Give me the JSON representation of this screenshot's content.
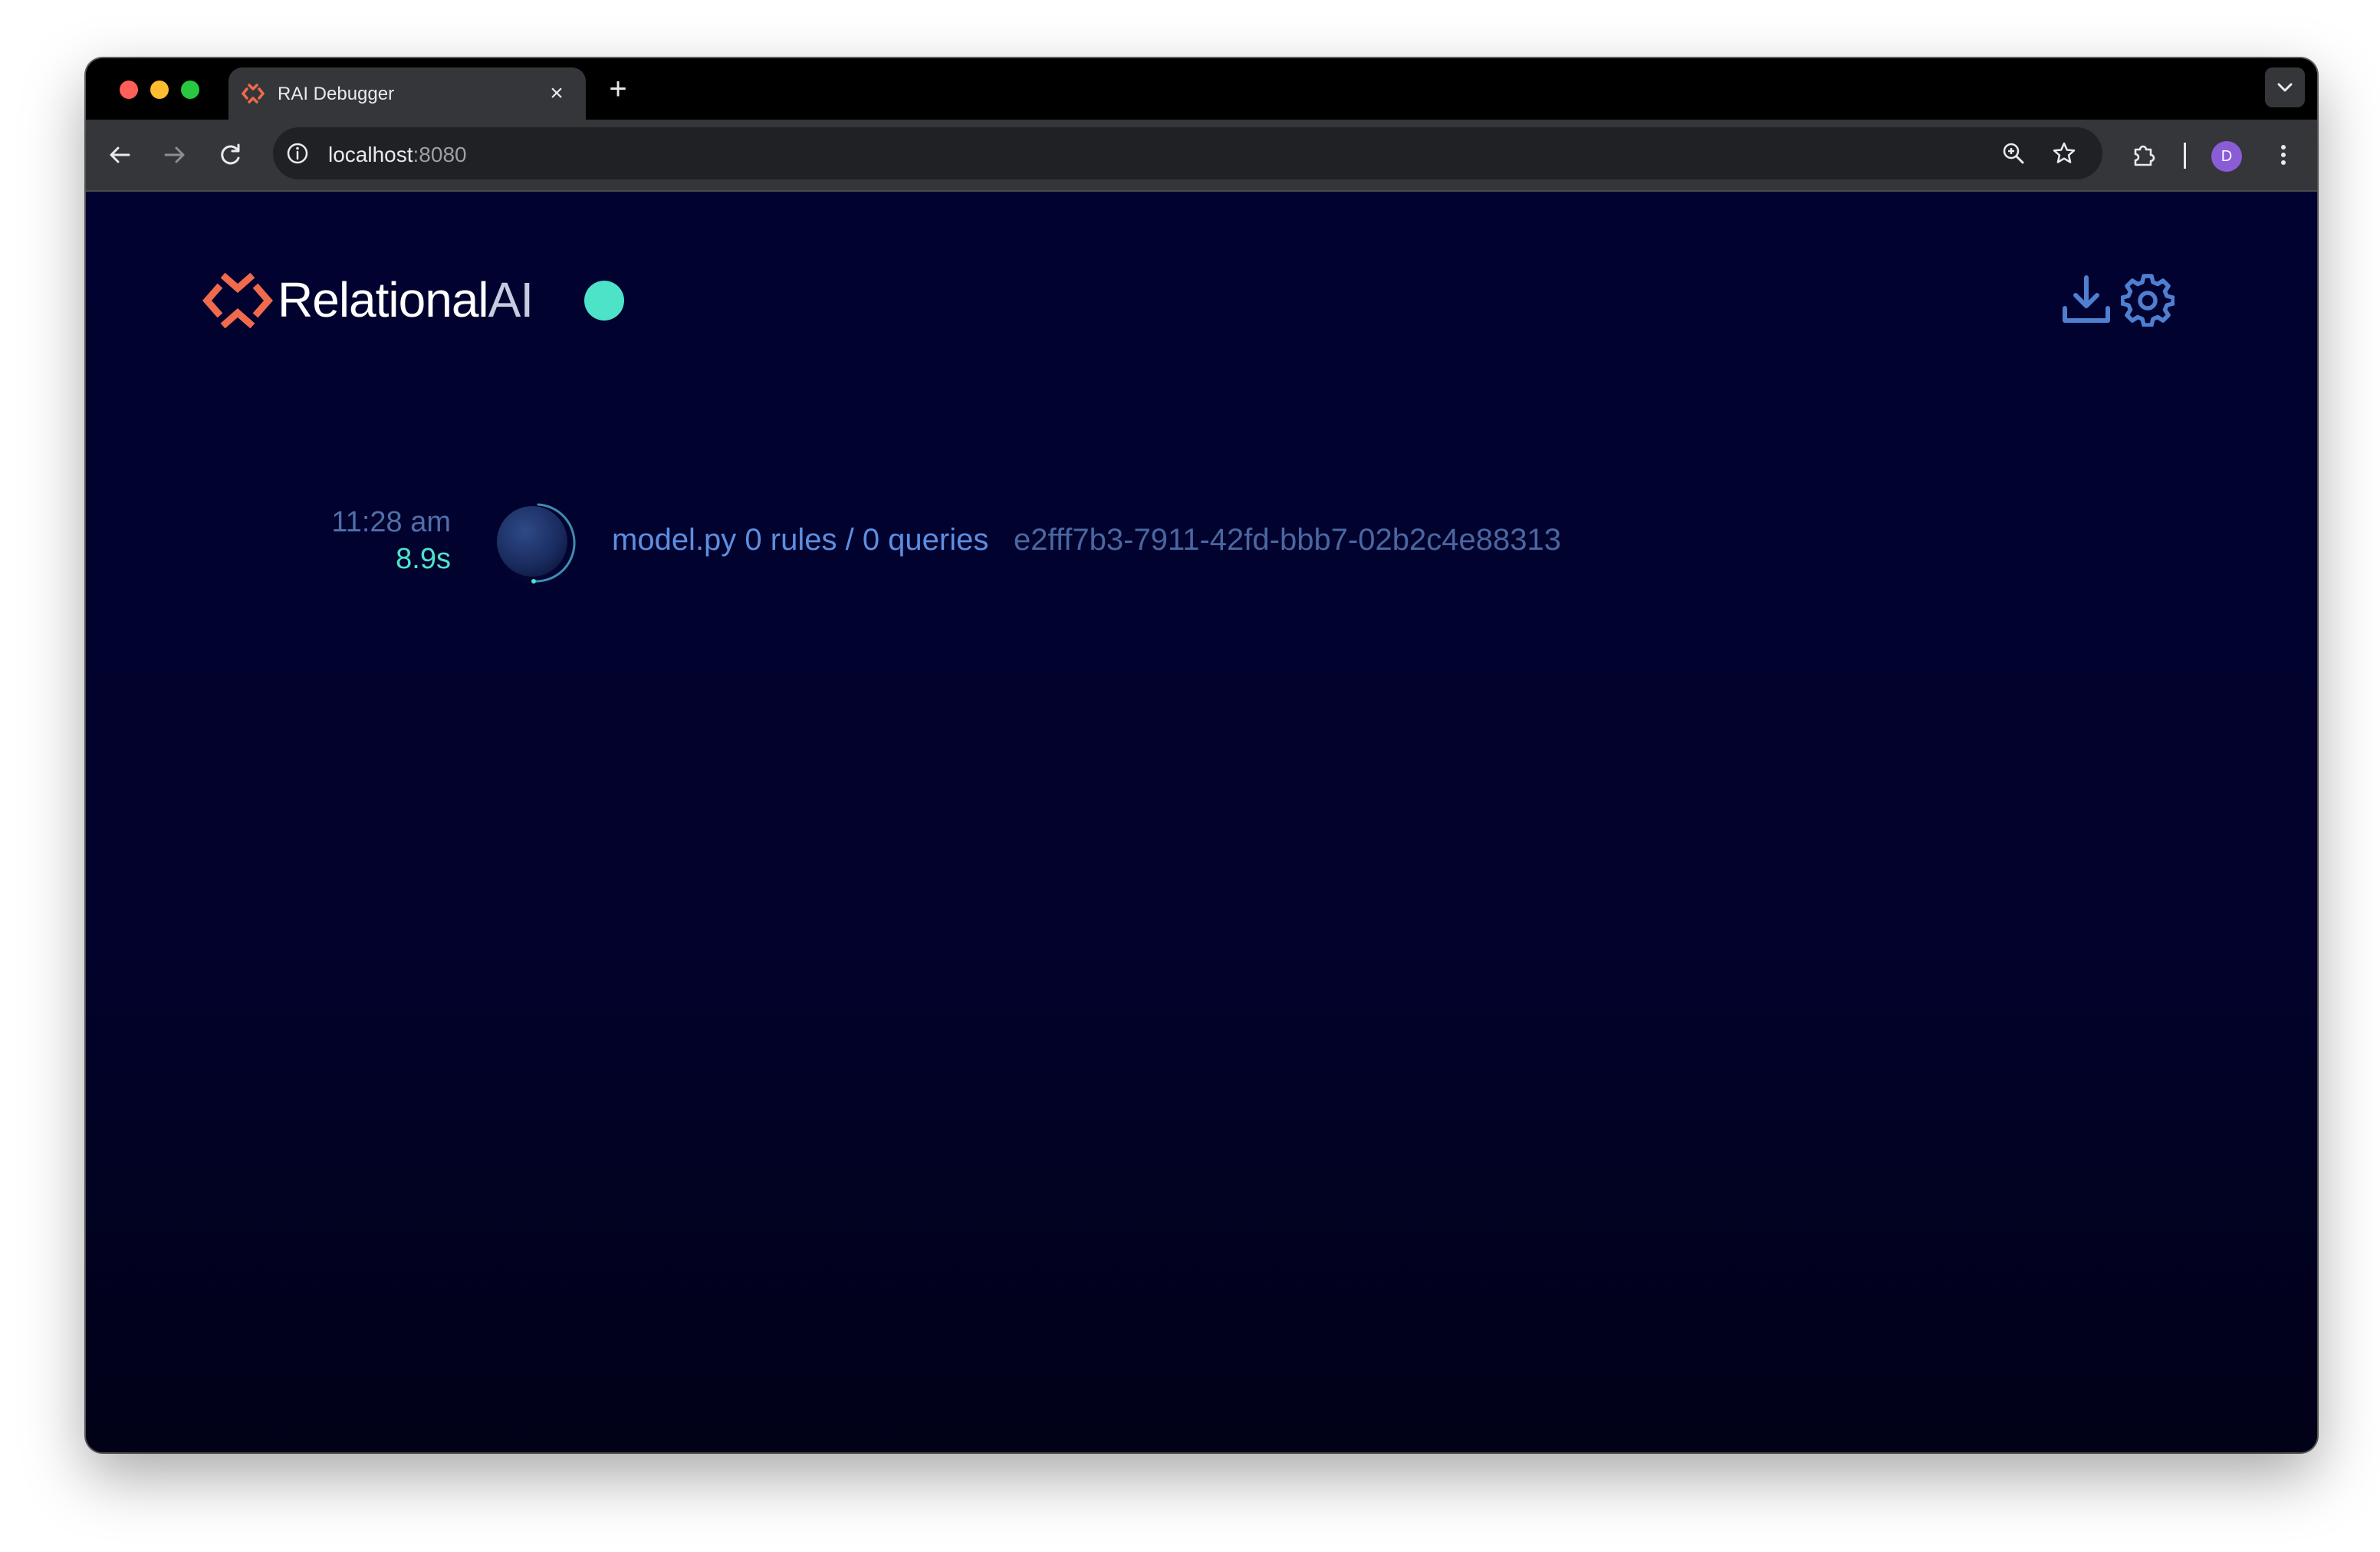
{
  "browser": {
    "tab_title": "RAI Debugger",
    "tab_close": "×",
    "new_tab": "+",
    "url_host": "localhost",
    "url_port": ":8080",
    "profile_initial": "D"
  },
  "header": {
    "brand_name": "Relational",
    "brand_suffix": "AI",
    "status_color": "#4de3c8",
    "accent_color": "#f06a4c"
  },
  "transactions": [
    {
      "time": "11:28 am",
      "duration": "8.9s",
      "label": "model.py 0 rules / 0 queries",
      "id": "e2fff7b3-7911-42fd-bbb7-02b2c4e88313"
    }
  ]
}
